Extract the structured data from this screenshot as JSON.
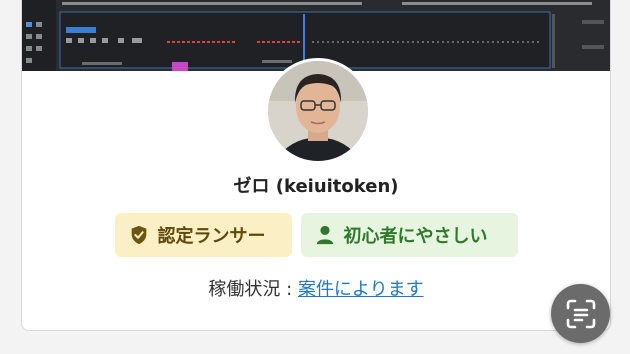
{
  "profile": {
    "username": "ゼロ (keiuitoken)",
    "avatar_icon": "user-avatar-photo"
  },
  "badges": [
    {
      "label": "認定ランサー",
      "icon": "shield-check-icon",
      "bg": "#fbefc6",
      "fg": "#5f4a0c"
    },
    {
      "label": "初心者にやさしい",
      "icon": "person-icon",
      "bg": "#e7f4df",
      "fg": "#2f7a2a"
    }
  ],
  "availability": {
    "label": "稼働状況 : ",
    "value": "案件によります"
  },
  "fab": {
    "icon": "text-scan-icon"
  },
  "colors": {
    "link": "#2277c7"
  }
}
